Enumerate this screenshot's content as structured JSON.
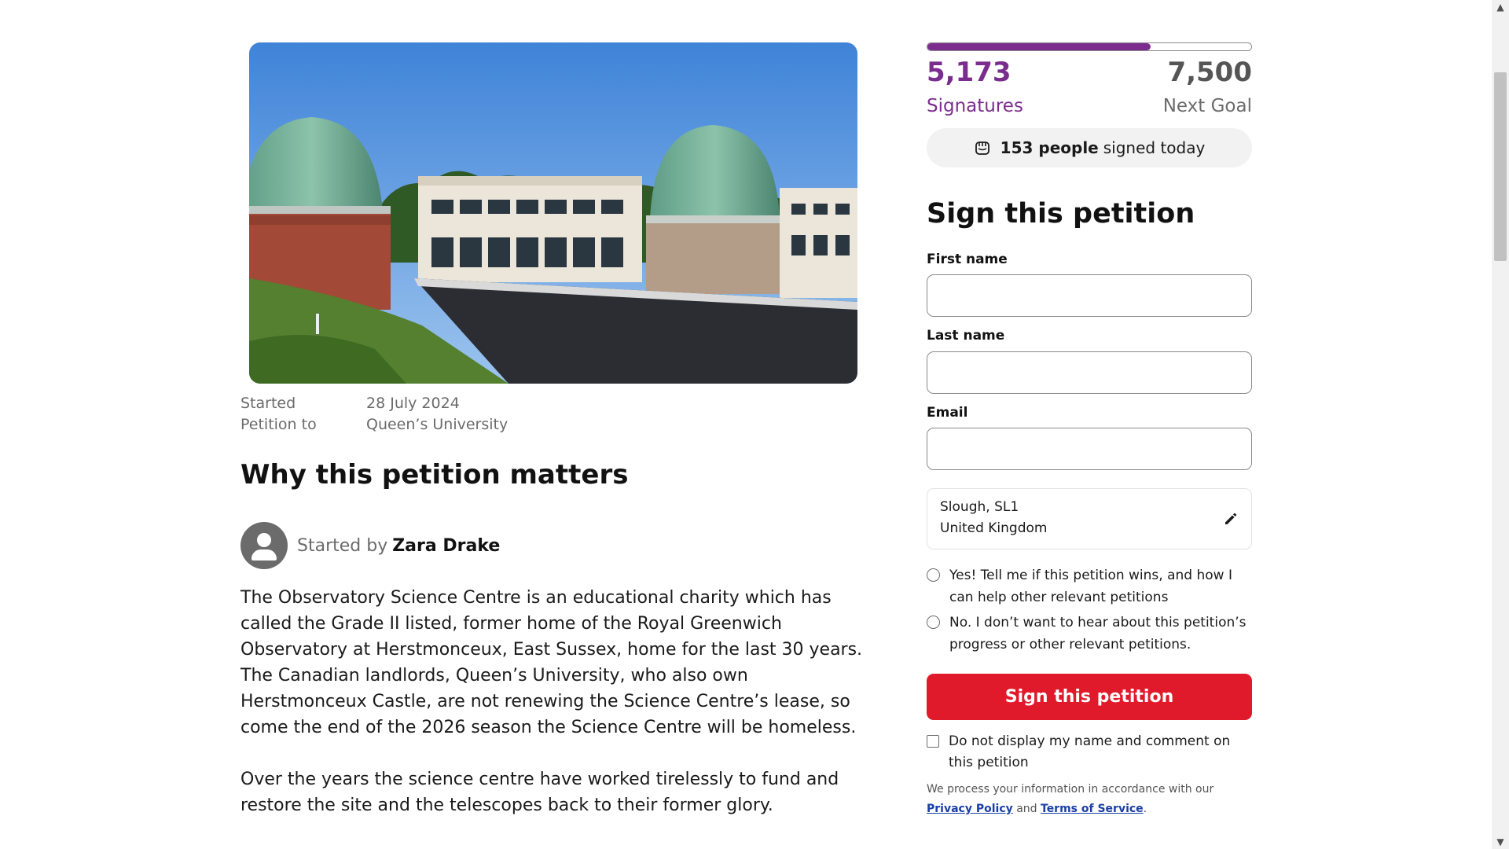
{
  "hero": {
    "image_alt": "Observatory domes at Herstmonceux"
  },
  "meta": {
    "started_label": "Started",
    "started_value": "28 July 2024",
    "petition_to_label": "Petition to",
    "petition_to_value": "Queen’s University"
  },
  "section_title": "Why this petition matters",
  "starter": {
    "prefix": "Started by",
    "name": "Zara Drake"
  },
  "body": {
    "p1": "The Observatory Science Centre is an educational charity which has called the Grade II listed, former home of the Royal Greenwich Observatory at Herstmonceux, East Sussex, home for the last 30 years. The Canadian landlords, Queen’s University, who also own Herstmonceux Castle, are not renewing the Science Centre’s lease, so come the end of the 2026 season the Science Centre will be homeless.",
    "p2": "Over the years the science centre have worked tirelessly to fund and restore the site and the telescopes back to their former glory."
  },
  "progress": {
    "signatures": "5,173",
    "signatures_label": "Signatures",
    "goal": "7,500",
    "goal_label": "Next Goal",
    "fraction": 0.69
  },
  "today": {
    "count": "153 people",
    "suffix": "signed today"
  },
  "form": {
    "title": "Sign this petition",
    "first_name_label": "First name",
    "last_name_label": "Last name",
    "email_label": "Email",
    "location_line1": "Slough, SL1",
    "location_line2": "United Kingdom",
    "opt_in_yes": "Yes! Tell me if this petition wins, and how I can help other relevant petitions",
    "opt_in_no": "No. I don’t want to hear about this petition’s progress or other relevant petitions.",
    "submit_label": "Sign this petition",
    "hide_name": "Do not display my name and comment on this petition",
    "privacy_prefix": "We process your information in accordance with our",
    "privacy_link": "Privacy Policy",
    "privacy_and": "and",
    "terms_link": "Terms of Service",
    "privacy_suffix": "."
  },
  "colors": {
    "brand_purple": "#7b2d8e",
    "cta_red": "#e01a2b"
  },
  "icons": [
    "fist-icon",
    "pencil-icon",
    "person-icon"
  ]
}
